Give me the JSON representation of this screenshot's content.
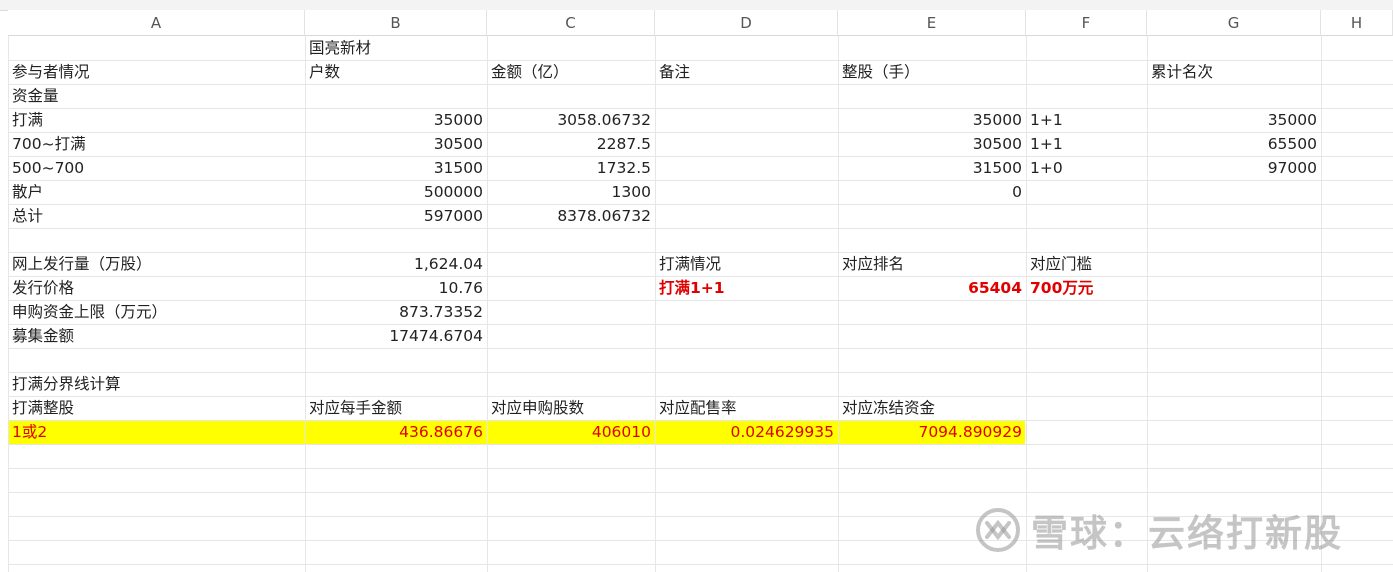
{
  "columns": [
    "A",
    "B",
    "C",
    "D",
    "E",
    "F",
    "G",
    "H"
  ],
  "sheet": {
    "r1": {
      "B": "国亮新材"
    },
    "r2": {
      "A": "参与者情况",
      "B": "户数",
      "C": "金额（亿）",
      "D": "备注",
      "E": "整股（手）",
      "G": "累计名次"
    },
    "r3": {
      "A": "资金量"
    },
    "r4": {
      "A": "打满",
      "B": "35000",
      "C": "3058.06732",
      "E": "35000",
      "F": "1+1",
      "G": "35000"
    },
    "r5": {
      "A": "700~打满",
      "B": "30500",
      "C": "2287.5",
      "E": "30500",
      "F": "1+1",
      "G": "65500"
    },
    "r6": {
      "A": "500~700",
      "B": "31500",
      "C": "1732.5",
      "E": "31500",
      "F": "1+0",
      "G": "97000"
    },
    "r7": {
      "A": "散户",
      "B": "500000",
      "C": "1300",
      "E": "0"
    },
    "r8": {
      "A": "总计",
      "B": "597000",
      "C": "8378.06732"
    },
    "r10": {
      "A": "网上发行量（万股）",
      "B": "1,624.04",
      "D": "打满情况",
      "E": "对应排名",
      "F": "对应门槛"
    },
    "r11": {
      "A": "发行价格",
      "B": "10.76",
      "D": "打满1+1",
      "E": "65404",
      "F": "700万元"
    },
    "r12": {
      "A": "申购资金上限（万元）",
      "B": "873.73352"
    },
    "r13": {
      "A": "募集金额",
      "B": "17474.6704"
    },
    "r15": {
      "A": "打满分界线计算"
    },
    "r16": {
      "A": "打满整股",
      "B": "对应每手金额",
      "C": "对应申购股数",
      "D": "对应配售率",
      "E": "对应冻结资金"
    },
    "r17": {
      "A": "1或2",
      "B": "436.86676",
      "C": "406010",
      "D": "0.024629935",
      "E": "7094.890929"
    }
  },
  "watermark": {
    "text": "雪球：云络打新股",
    "icon": "snowball-logo-icon"
  },
  "colors": {
    "highlight": "#ffff00",
    "emphasis": "#e00000"
  }
}
